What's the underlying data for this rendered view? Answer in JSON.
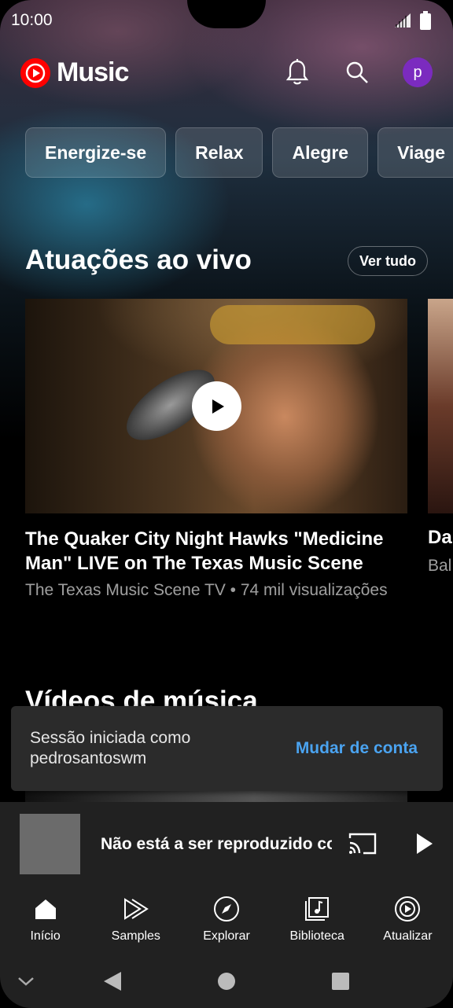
{
  "status_bar": {
    "time": "10:00"
  },
  "header": {
    "logo_text": "Music",
    "avatar_letter": "p",
    "icons": [
      "notifications-icon",
      "search-icon"
    ]
  },
  "chips": [
    {
      "label": "Energize-se"
    },
    {
      "label": "Relax"
    },
    {
      "label": "Alegre"
    },
    {
      "label": "Viage"
    }
  ],
  "live_section": {
    "title": "Atuações ao vivo",
    "see_all_label": "Ver tudo",
    "videos": [
      {
        "title": "The Quaker City Night Hawks \"Medicine Man\" LIVE on The Texas Music Scene",
        "meta": "The Texas Music Scene TV • 74 mil visualizações"
      },
      {
        "title": "Da",
        "meta": "Bal"
      }
    ]
  },
  "music_videos_section": {
    "title": "Vídeos de música"
  },
  "toast": {
    "message": "Sessão iniciada como pedrosantoswm",
    "action_label": "Mudar de conta"
  },
  "mini_player": {
    "title": "Não está a ser reproduzido conteúdo"
  },
  "bottom_nav": [
    {
      "label": "Início",
      "icon": "home-icon"
    },
    {
      "label": "Samples",
      "icon": "samples-icon"
    },
    {
      "label": "Explorar",
      "icon": "compass-icon"
    },
    {
      "label": "Biblioteca",
      "icon": "library-icon"
    },
    {
      "label": "Atualizar",
      "icon": "upgrade-icon"
    }
  ],
  "colors": {
    "brand_red": "#ff0000",
    "avatar_purple": "#7b2bbf",
    "link_blue": "#4aa3f0",
    "surface": "#212121"
  }
}
